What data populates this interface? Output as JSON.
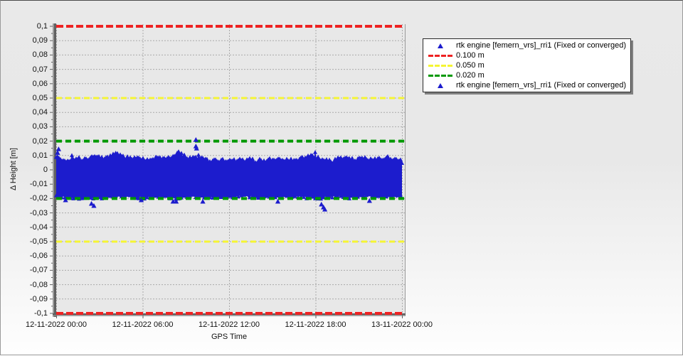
{
  "chart_data": {
    "type": "scatter",
    "title": "",
    "xlabel": "GPS Time",
    "ylabel": "Δ Height [m]",
    "ylim": [
      -0.1,
      0.1
    ],
    "grid": true,
    "x_ticks": [
      {
        "label": "12-11-2022 00:00",
        "f": 0.0
      },
      {
        "label": "12-11-2022 06:00",
        "f": 0.25
      },
      {
        "label": "12-11-2022 12:00",
        "f": 0.5
      },
      {
        "label": "12-11-2022 18:00",
        "f": 0.75
      },
      {
        "label": "13-11-2022 00:00",
        "f": 1.0
      }
    ],
    "y_ticks": [
      {
        "label": "0,1",
        "v": 0.1
      },
      {
        "label": "0,09",
        "v": 0.09
      },
      {
        "label": "0,08",
        "v": 0.08
      },
      {
        "label": "0,07",
        "v": 0.07
      },
      {
        "label": "0,06",
        "v": 0.06
      },
      {
        "label": "0,05",
        "v": 0.05
      },
      {
        "label": "0,04",
        "v": 0.04
      },
      {
        "label": "0,03",
        "v": 0.03
      },
      {
        "label": "0,02",
        "v": 0.02
      },
      {
        "label": "0,01",
        "v": 0.01
      },
      {
        "label": "0",
        "v": 0.0
      },
      {
        "label": "-0,01",
        "v": -0.01
      },
      {
        "label": "-0,02",
        "v": -0.02
      },
      {
        "label": "-0,03",
        "v": -0.03
      },
      {
        "label": "-0,04",
        "v": -0.04
      },
      {
        "label": "-0,05",
        "v": -0.05
      },
      {
        "label": "-0,06",
        "v": -0.06
      },
      {
        "label": "-0,07",
        "v": -0.07
      },
      {
        "label": "-0,08",
        "v": -0.08
      },
      {
        "label": "-0,09",
        "v": -0.09
      },
      {
        "label": "-0,1",
        "v": -0.1
      }
    ],
    "limit_lines": [
      {
        "name": "0.100 m",
        "value": 0.1,
        "color": "#ee2222",
        "width": 4,
        "dash": "10 4"
      },
      {
        "name": "0.100 m",
        "value": -0.1,
        "color": "#ee2222",
        "width": 4,
        "dash": "10 4"
      },
      {
        "name": "0.050 m",
        "value": 0.05,
        "color": "#f5f533",
        "width": 3,
        "dash": "8 5"
      },
      {
        "name": "0.050 m",
        "value": -0.05,
        "color": "#f5f533",
        "width": 3,
        "dash": "8 5"
      },
      {
        "name": "0.020 m",
        "value": 0.02,
        "color": "#009900",
        "width": 4,
        "dash": "8 5"
      },
      {
        "name": "0.020 m",
        "value": -0.02,
        "color": "#009900",
        "width": 4,
        "dash": "8 5"
      }
    ],
    "series": [
      {
        "name": "rtk engine [femern_vrs]_rri1 (Fixed or converged)",
        "marker": "triangle",
        "color": "#1c1ccd",
        "band": {
          "seed": 1337,
          "upper_envelope": [
            [
              0.0,
              0.01
            ],
            [
              0.02,
              0.006
            ],
            [
              0.05,
              0.008
            ],
            [
              0.08,
              0.0075
            ],
            [
              0.11,
              0.009
            ],
            [
              0.14,
              0.008
            ],
            [
              0.17,
              0.0112
            ],
            [
              0.2,
              0.009
            ],
            [
              0.23,
              0.008
            ],
            [
              0.26,
              0.007
            ],
            [
              0.29,
              0.008
            ],
            [
              0.32,
              0.007
            ],
            [
              0.355,
              0.0122
            ],
            [
              0.38,
              0.008
            ],
            [
              0.41,
              0.0085
            ],
            [
              0.44,
              0.0065
            ],
            [
              0.47,
              0.006
            ],
            [
              0.5,
              0.007
            ],
            [
              0.53,
              0.0058
            ],
            [
              0.56,
              0.007
            ],
            [
              0.59,
              0.006
            ],
            [
              0.62,
              0.0072
            ],
            [
              0.65,
              0.008
            ],
            [
              0.68,
              0.0068
            ],
            [
              0.71,
              0.008
            ],
            [
              0.74,
              0.0095
            ],
            [
              0.77,
              0.007
            ],
            [
              0.8,
              0.006
            ],
            [
              0.83,
              0.009
            ],
            [
              0.86,
              0.007
            ],
            [
              0.89,
              0.008
            ],
            [
              0.92,
              0.0068
            ],
            [
              0.95,
              0.009
            ],
            [
              0.98,
              0.007
            ],
            [
              1.0,
              0.006
            ]
          ],
          "lower_envelope": [
            [
              0.0,
              -0.019
            ],
            [
              0.05,
              -0.0195
            ],
            [
              0.1,
              -0.0205
            ],
            [
              0.15,
              -0.019
            ],
            [
              0.2,
              -0.0185
            ],
            [
              0.25,
              -0.0198
            ],
            [
              0.3,
              -0.019
            ],
            [
              0.35,
              -0.0202
            ],
            [
              0.4,
              -0.0188
            ],
            [
              0.45,
              -0.0195
            ],
            [
              0.5,
              -0.019
            ],
            [
              0.55,
              -0.0185
            ],
            [
              0.6,
              -0.0198
            ],
            [
              0.65,
              -0.019
            ],
            [
              0.7,
              -0.0192
            ],
            [
              0.75,
              -0.02
            ],
            [
              0.8,
              -0.0188
            ],
            [
              0.85,
              -0.0195
            ],
            [
              0.9,
              -0.0185
            ],
            [
              0.95,
              -0.0192
            ],
            [
              1.0,
              -0.019
            ]
          ]
        },
        "outliers_high": [
          [
            0.004,
            0.012
          ],
          [
            0.007,
            0.0145
          ],
          [
            0.172,
            0.0115
          ],
          [
            0.354,
            0.0125
          ],
          [
            0.404,
            0.021
          ],
          [
            0.404,
            0.0165
          ],
          [
            0.406,
            0.015
          ]
        ],
        "outliers_low": [
          [
            0.027,
            -0.021
          ],
          [
            0.102,
            -0.0235
          ],
          [
            0.109,
            -0.025
          ],
          [
            0.246,
            -0.021
          ],
          [
            0.338,
            -0.022
          ],
          [
            0.347,
            -0.022
          ],
          [
            0.424,
            -0.022
          ],
          [
            0.641,
            -0.022
          ],
          [
            0.767,
            -0.024
          ],
          [
            0.773,
            -0.026
          ],
          [
            0.777,
            -0.0275
          ],
          [
            0.906,
            -0.0215
          ]
        ]
      }
    ],
    "legend": {
      "position": "outside-right-top",
      "entries": [
        {
          "marker": "triangle",
          "color": "#1c1ccd",
          "label": "rtk engine [femern_vrs]_rri1 (Fixed or converged)"
        },
        {
          "marker": "dashes",
          "color": "#ee2222",
          "label": "0.100 m"
        },
        {
          "marker": "dashes",
          "color": "#f5f533",
          "label": "0.050 m"
        },
        {
          "marker": "dashes",
          "color": "#009900",
          "label": "0.020 m"
        },
        {
          "marker": "triangle",
          "color": "#1c1ccd",
          "label": "rtk engine [femern_vrs]_rri1 (Fixed or converged)"
        }
      ]
    },
    "colors": {
      "plot_bg": "#e8e8e8",
      "grid": "#aaaaaa",
      "axis": "#606060",
      "axis_light": "#9b9b9b",
      "text": "#111111"
    }
  }
}
